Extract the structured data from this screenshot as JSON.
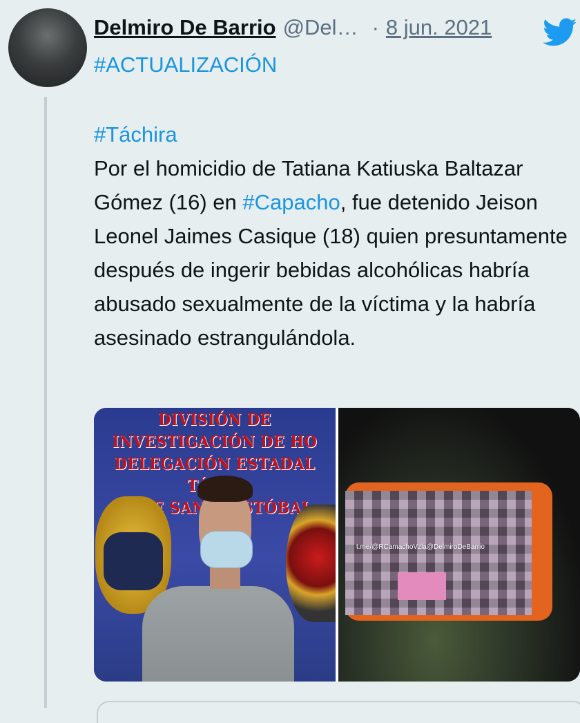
{
  "tweet": {
    "author_name": "Delmiro De Barrio",
    "handle": "@Del…",
    "separator": "·",
    "date": "8 jun. 2021",
    "top_hashtag": "#ACTUALIZACIÓN",
    "hashtag_line": "#Táchira",
    "text_part1": "Por el homicidio de Tatiana Katiuska Baltazar Gómez (16) en ",
    "text_hashtag": "#Capacho",
    "text_part2": ", fue detenido Jeison Leonel Jaimes Casique (18) quien presuntamente después de ingerir bebidas alcohólicas habría abusado sexualmente de la víctima y la habría asesinado estrangulándola."
  },
  "media": {
    "left_photo_banner_1": "DIVISIÓN DE INVESTIGACIÓN DE HO",
    "left_photo_banner_2": "DELEGACIÓN ESTADAL TÁCHI",
    "left_photo_banner_3": "BASE SAN CRISTÓBAL",
    "right_photo_watermark": "t.me/@RCamachoVzla@DelmiroDeBarrio"
  },
  "icons": {
    "brand": "twitter-bird-icon"
  },
  "colors": {
    "link": "#1b95e0",
    "background": "#e6eef0",
    "secondary_text": "#5b7083",
    "twitter_blue": "#1d9bf0"
  }
}
